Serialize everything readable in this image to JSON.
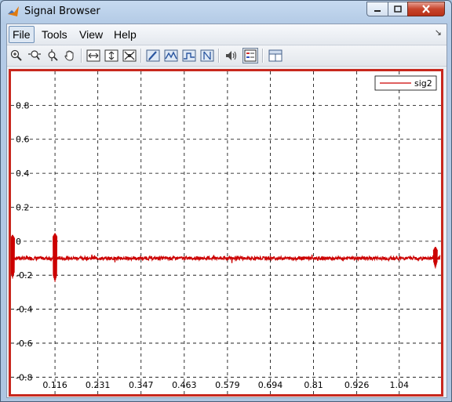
{
  "window": {
    "title": "Signal Browser"
  },
  "menu": {
    "file": "File",
    "tools": "Tools",
    "view": "View",
    "help": "Help"
  },
  "toolbar": {
    "buttons": [
      "zoom-in",
      "zoom-x",
      "zoom-y",
      "pan",
      "fit-x",
      "fit-y",
      "fit-all",
      "measure-1",
      "measure-2",
      "measure-3",
      "measure-4",
      "speaker",
      "legend-toggle",
      "panel-layout"
    ]
  },
  "colors": {
    "signal": "#cc0000",
    "frame": "#c8281e"
  },
  "chart_data": {
    "type": "line",
    "legend": {
      "label": "sig2",
      "placement": "top-right"
    },
    "grid": true,
    "xticks": [
      "0.116",
      "0.231",
      "0.347",
      "0.463",
      "0.579",
      "0.694",
      "0.81",
      "0.926",
      "1.04"
    ],
    "yticks": [
      "0.8",
      "0.6",
      "0.4",
      "0.2",
      "0",
      "-0.2",
      "-0.4",
      "-0.6",
      "-0.8"
    ],
    "xlim": [
      0,
      1.15
    ],
    "ylim": [
      -0.9,
      1.0
    ],
    "series": [
      {
        "name": "sig2",
        "baseline": -0.1,
        "noise_amplitude": 0.01,
        "spikes": [
          {
            "x": 0.0,
            "min": -0.22,
            "max": 0.04
          },
          {
            "x": 0.116,
            "min": -0.24,
            "max": 0.05
          },
          {
            "x": 1.137,
            "min": -0.16,
            "max": -0.03
          }
        ]
      }
    ]
  }
}
